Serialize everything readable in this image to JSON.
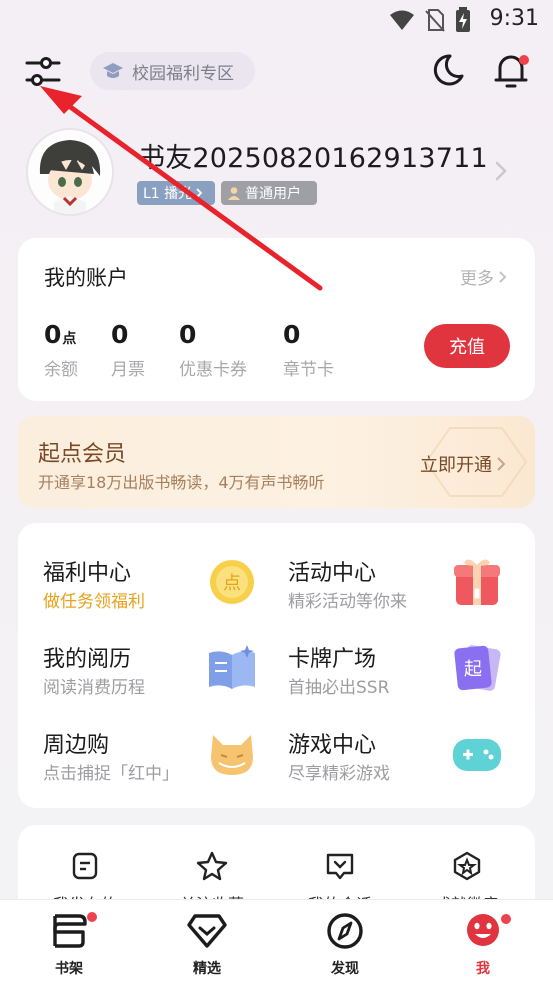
{
  "status_bar": {
    "time": "9:31",
    "icons": [
      "wifi-icon",
      "no-sim-icon",
      "battery-charging-icon"
    ]
  },
  "header": {
    "filter_icon": "sliders-icon",
    "campus_label": "校园福利专区",
    "campus_icon": "graduation-cap-icon",
    "night_mode_icon": "moon-icon",
    "notification_icon": "bell-icon"
  },
  "profile": {
    "username": "书友20250820162913711",
    "level_badge": "L1 播光",
    "role_badge": "普通用户"
  },
  "account": {
    "title": "我的账户",
    "more_label": "更多",
    "stats": [
      {
        "value": "0",
        "unit": "点",
        "label": "余额"
      },
      {
        "value": "0",
        "unit": "",
        "label": "月票"
      },
      {
        "value": "0",
        "unit": "",
        "label": "优惠卡券"
      },
      {
        "value": "0",
        "unit": "",
        "label": "章节卡"
      }
    ],
    "recharge_label": "充值"
  },
  "vip": {
    "title": "起点会员",
    "subtitle": "开通享18万出版书畅读，4万有声书畅听",
    "action_label": "立即开通"
  },
  "features": [
    {
      "title": "福利中心",
      "subtitle": "做任务领福利",
      "icon": "coin-icon",
      "highlight": true
    },
    {
      "title": "活动中心",
      "subtitle": "精彩活动等你来",
      "icon": "gift-box-icon",
      "highlight": false
    },
    {
      "title": "我的阅历",
      "subtitle": "阅读消费历程",
      "icon": "open-book-icon",
      "highlight": false
    },
    {
      "title": "卡牌广场",
      "subtitle": "首抽必出SSR",
      "icon": "card-deck-icon",
      "highlight": false
    },
    {
      "title": "周边购",
      "subtitle": "点击捕捉「红中」",
      "icon": "fox-mascot-icon",
      "highlight": false
    },
    {
      "title": "游戏中心",
      "subtitle": "尽享精彩游戏",
      "icon": "gamepad-icon",
      "highlight": false
    }
  ],
  "shortcuts": [
    {
      "label": "我发布的",
      "icon": "note-icon"
    },
    {
      "label": "关注收藏",
      "icon": "star-icon"
    },
    {
      "label": "我的会话",
      "icon": "chat-heart-icon"
    },
    {
      "label": "成就徽章",
      "icon": "badge-star-icon"
    }
  ],
  "tabbar": [
    {
      "label": "书架",
      "icon": "bookshelf-icon",
      "active": false,
      "dot": true
    },
    {
      "label": "精选",
      "icon": "diamond-icon",
      "active": false,
      "dot": false
    },
    {
      "label": "发现",
      "icon": "compass-icon",
      "active": false,
      "dot": false
    },
    {
      "label": "我",
      "icon": "profile-face-icon",
      "active": true,
      "dot": true
    }
  ],
  "colors": {
    "accent": "#e0343f",
    "vip_text": "#7a4a26",
    "highlight_subtitle": "#e6a21a",
    "annotation_arrow": "#e8232b"
  }
}
